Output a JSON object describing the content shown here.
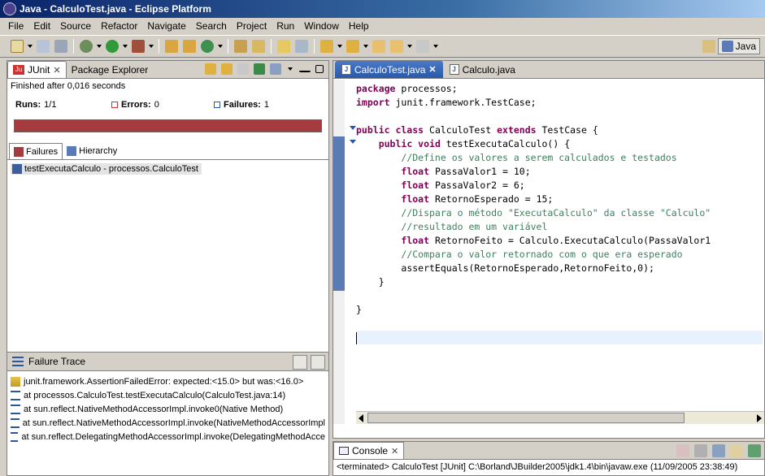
{
  "window": {
    "title": "Java - CalculoTest.java - Eclipse Platform"
  },
  "menu": [
    "File",
    "Edit",
    "Source",
    "Refactor",
    "Navigate",
    "Search",
    "Project",
    "Run",
    "Window",
    "Help"
  ],
  "perspective": {
    "label": "Java"
  },
  "junit_view": {
    "tab_label": "JUnit",
    "other_tab_label": "Package Explorer",
    "finished_text": "Finished after 0,016 seconds",
    "runs_label": "Runs:",
    "runs_value": "1/1",
    "errors_label": "Errors:",
    "errors_value": "0",
    "failures_label": "Failures:",
    "failures_value": "1",
    "progress_color": "#a43b3f",
    "failures_tab": "Failures",
    "hierarchy_tab": "Hierarchy",
    "failure_item": "testExecutaCalculo - processos.CalculoTest"
  },
  "failure_trace": {
    "title": "Failure Trace",
    "lines": [
      "junit.framework.AssertionFailedError: expected:<15.0> but was:<16.0>",
      "at processos.CalculoTest.testExecutaCalculo(CalculoTest.java:14)",
      "at sun.reflect.NativeMethodAccessorImpl.invoke0(Native Method)",
      "at sun.reflect.NativeMethodAccessorImpl.invoke(NativeMethodAccessorImpl",
      "at sun.reflect.DelegatingMethodAccessorImpl.invoke(DelegatingMethodAcce"
    ]
  },
  "editor": {
    "tabs": [
      "CalculoTest.java",
      "Calculo.java"
    ],
    "code": {
      "l1_kw": "package",
      "l1_rest": " processos;",
      "l2_kw": "import",
      "l2_rest": " junit.framework.TestCase;",
      "l4_kw1": "public class",
      "l4_mid": " CalculoTest ",
      "l4_kw2": "extends",
      "l4_rest": " TestCase {",
      "l5_kw": "public void",
      "l5_rest": " testExecutaCalculo() {",
      "l6_cm": "//Define os valores a serem calculados e testados",
      "l7_kw": "float",
      "l7_rest": " PassaValor1 = 10;",
      "l8_kw": "float",
      "l8_rest": " PassaValor2 = 6;",
      "l9_kw": "float",
      "l9_rest": " RetornoEsperado = 15;",
      "l10_cm": "//Dispara o método \"ExecutaCalculo\" da classe \"Calculo\"",
      "l11_cm": "//resultado em um variável",
      "l12_kw": "float",
      "l12_rest": " RetornoFeito = Calculo.ExecutaCalculo(PassaValor1",
      "l13_cm": "//Compara o valor retornado com o que era esperado",
      "l14": "assertEquals(RetornoEsperado,RetornoFeito,0);",
      "l15": "}",
      "l17": "}"
    }
  },
  "console": {
    "tab_label": "Console",
    "text": "<terminated> CalculoTest [JUnit] C:\\Borland\\JBuilder2005\\jdk1.4\\bin\\javaw.exe (11/09/2005 23:38:49)"
  }
}
